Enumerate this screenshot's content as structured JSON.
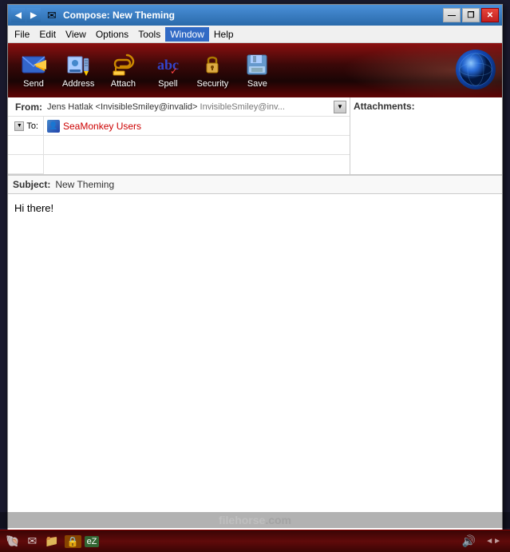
{
  "window": {
    "title": "Compose: New Theming",
    "icon": "✉"
  },
  "title_buttons": {
    "minimize": "—",
    "restore": "❐",
    "close": "✕",
    "nav_left": "◀",
    "nav_right": "▶"
  },
  "menu": {
    "items": [
      "File",
      "Edit",
      "View",
      "Options",
      "Tools",
      "Window",
      "Help"
    ]
  },
  "toolbar": {
    "buttons": [
      {
        "id": "send",
        "label": "Send",
        "icon": "send"
      },
      {
        "id": "address",
        "label": "Address",
        "icon": "address"
      },
      {
        "id": "attach",
        "label": "Attach",
        "icon": "attach"
      },
      {
        "id": "spell",
        "label": "Spell",
        "icon": "spell"
      },
      {
        "id": "security",
        "label": "Security",
        "icon": "security"
      },
      {
        "id": "save",
        "label": "Save",
        "icon": "save"
      }
    ]
  },
  "compose": {
    "from_label": "From:",
    "from_value": "Jens Hatlak <InvisibleSmiley@invalid>",
    "from_secondary": "InvisibleSmiley@inv...",
    "to_label": "To:",
    "recipient_name": "SeaMonkey Users",
    "attachments_label": "Attachments:",
    "subject_label": "Subject:",
    "subject_value": "New Theming",
    "message_body": "Hi there!"
  },
  "taskbar": {
    "icons": [
      "🐚",
      "✉",
      "📁",
      "🔒",
      "eZ"
    ],
    "right_icons": [
      "🔊"
    ]
  },
  "watermark": {
    "text": "filehorse",
    "suffix": ".com"
  }
}
